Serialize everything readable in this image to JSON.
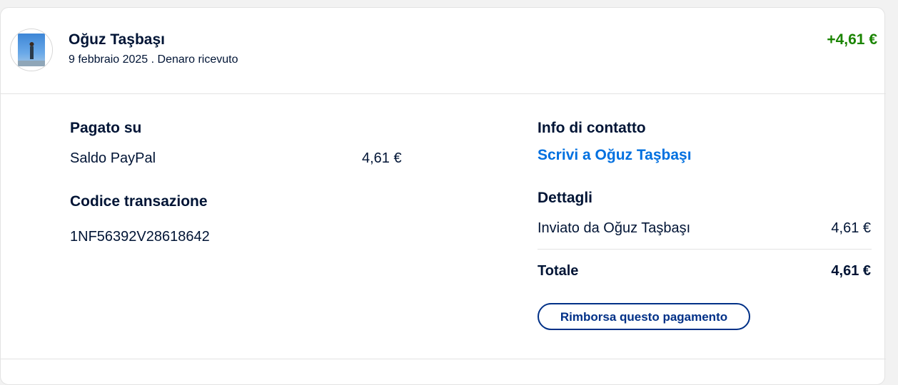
{
  "header": {
    "name": "Oğuz Taşbaşı",
    "subline": "9 febbraio 2025 . Denaro ricevuto",
    "amount": "+4,61 €",
    "amount_color": "#1a8400",
    "avatar_icon": "user-photo-avatar"
  },
  "payment": {
    "heading": "Pagato su",
    "method": "Saldo PayPal",
    "method_amount": "4,61 €"
  },
  "transaction": {
    "heading": "Codice transazione",
    "code": "1NF56392V28618642"
  },
  "contact": {
    "heading": "Info di contatto",
    "link_label": "Scrivi a Oğuz Taşbaşı",
    "link_color": "#0070e0"
  },
  "details": {
    "heading": "Dettagli",
    "sent_by_label": "Inviato da Oğuz Taşbaşı",
    "sent_by_amount": "4,61 €",
    "total_label": "Totale",
    "total_amount": "4,61 €"
  },
  "actions": {
    "refund_label": "Rimborsa questo pagamento",
    "refund_color": "#003087"
  }
}
